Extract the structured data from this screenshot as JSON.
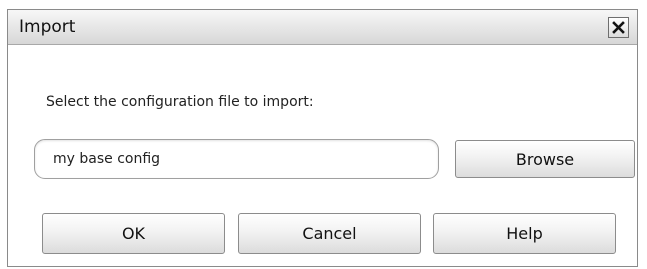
{
  "dialog": {
    "title": "Import",
    "close_icon": "close-icon",
    "prompt": "Select the configuration file to import:",
    "file_input": {
      "value": "my base config",
      "placeholder": ""
    },
    "buttons": {
      "browse": "Browse",
      "ok": "OK",
      "cancel": "Cancel",
      "help": "Help"
    }
  }
}
